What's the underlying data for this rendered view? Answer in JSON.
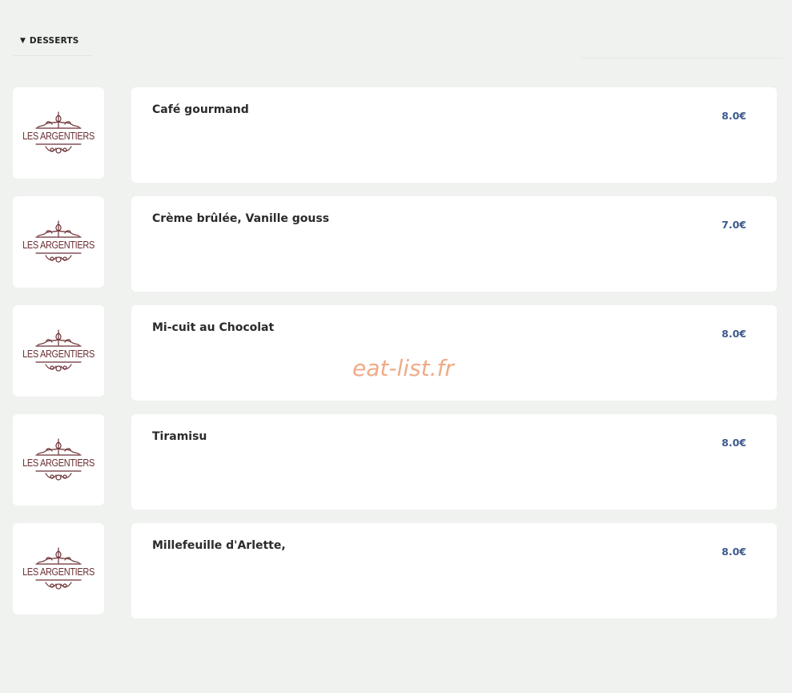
{
  "section": {
    "title": "DESSERTS",
    "toggle_glyph": "▼"
  },
  "logo_text": "LES ARGENTIERS",
  "items": [
    {
      "name": "Café gourmand",
      "price": "8.0€"
    },
    {
      "name": "Crème brûlée, Vanille gouss",
      "price": "7.0€"
    },
    {
      "name": "Mi-cuit au Chocolat",
      "price": "8.0€"
    },
    {
      "name": "Tiramisu",
      "price": "8.0€"
    },
    {
      "name": "Millefeuille d'Arlette,",
      "price": "8.0€"
    }
  ],
  "watermark": "eat-list.fr",
  "colors": {
    "background": "#eff2ef",
    "card": "#ffffff",
    "price": "#3d5a8c",
    "logo": "#6b2f33",
    "watermark": "#eea27a"
  }
}
